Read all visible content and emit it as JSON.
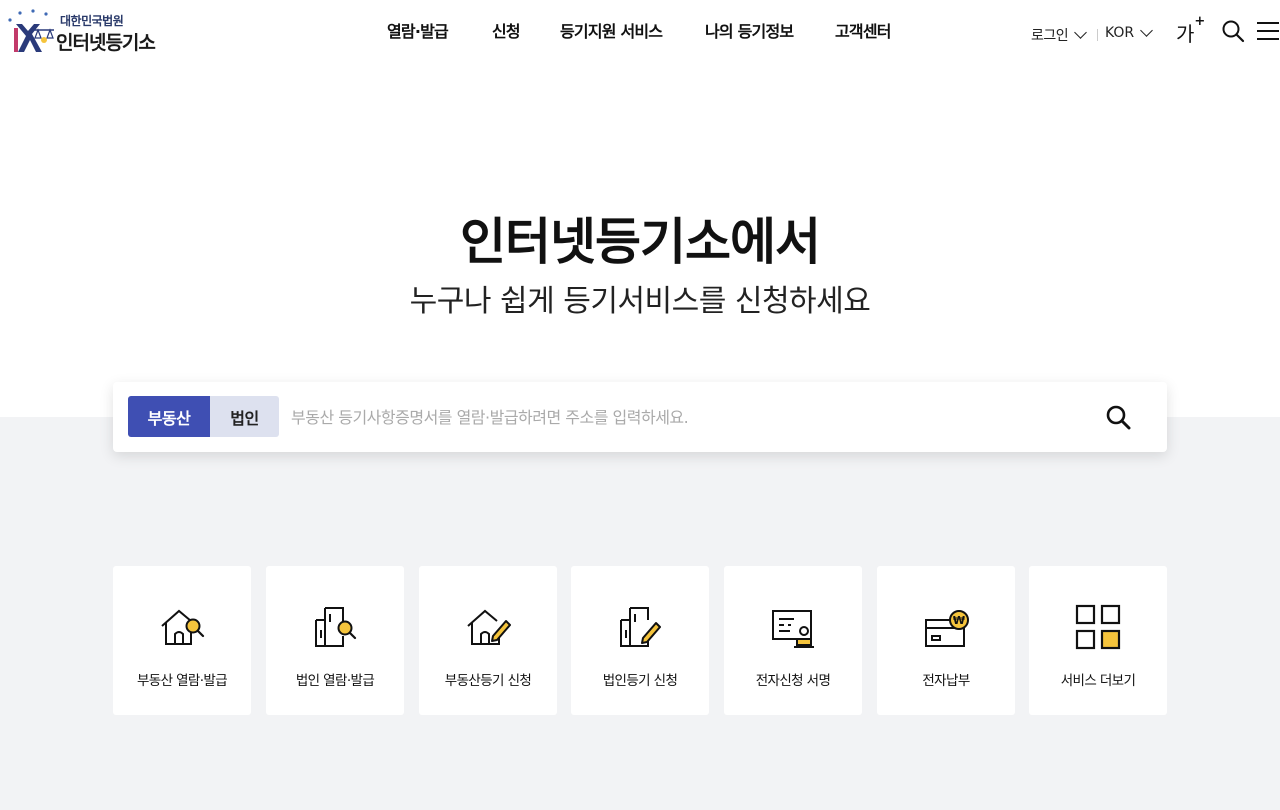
{
  "header": {
    "logo_small": "대한민국법원",
    "logo_big": "인터넷등기소",
    "nav": [
      "열람·발급",
      "신청",
      "등기지원 서비스",
      "나의 등기정보",
      "고객센터"
    ],
    "login_label": "로그인",
    "language_label": "KOR",
    "font_size_label": "가",
    "font_size_plus": "+"
  },
  "hero": {
    "title": "인터넷등기소에서",
    "subtitle": "누구나 쉽게 등기서비스를 신청하세요"
  },
  "search": {
    "tabs": [
      "부동산",
      "법인"
    ],
    "active_tab": "부동산",
    "placeholder": "부동산 등기사항증명서를 열람·발급하려면 주소를 입력하세요.",
    "value": ""
  },
  "services": [
    {
      "label": "부동산 열람·발급",
      "icon": "house-search-icon"
    },
    {
      "label": "법인 열람·발급",
      "icon": "building-search-icon"
    },
    {
      "label": "부동산등기 신청",
      "icon": "house-pen-icon"
    },
    {
      "label": "법인등기 신청",
      "icon": "building-pen-icon"
    },
    {
      "label": "전자신청 서명",
      "icon": "e-sign-icon"
    },
    {
      "label": "전자납부",
      "icon": "card-payment-icon"
    },
    {
      "label": "서비스 더보기",
      "icon": "grid-more-icon"
    }
  ],
  "colors": {
    "accent": "#3f4fb3",
    "tab_inactive": "#dde1ef",
    "icon_yellow": "#f5c43c",
    "band": "#f2f3f5"
  }
}
